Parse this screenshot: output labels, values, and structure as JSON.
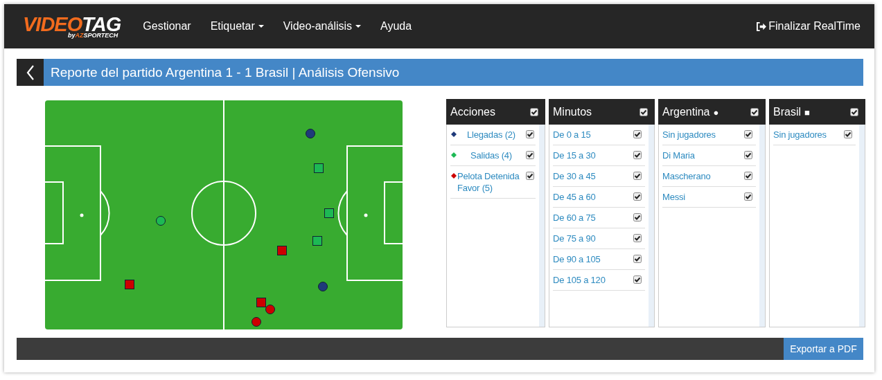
{
  "logo": {
    "main_a": "VIDEO",
    "main_b": "TAG",
    "by": "by",
    "brand_a": "AZ",
    "brand_b": "SPORTECH"
  },
  "nav": [
    {
      "label": "Gestionar",
      "has_dropdown": false
    },
    {
      "label": "Etiquetar",
      "has_dropdown": true
    },
    {
      "label": "Video-análisis",
      "has_dropdown": true
    },
    {
      "label": "Ayuda",
      "has_dropdown": false
    }
  ],
  "exit_button": "Finalizar RealTime",
  "title": "Reporte del partido Argentina 1 - 1 Brasil | Análisis Ofensivo",
  "panels": [
    {
      "title": "Acciones",
      "checked": true,
      "items": [
        {
          "label": "Llegadas (2)",
          "checked": true,
          "color": "#1f3a7a"
        },
        {
          "label": "Salidas (4)",
          "checked": true,
          "color": "#1db954"
        },
        {
          "label": "Pelota Detenida Favor (5)",
          "checked": true,
          "color": "#cc0000"
        }
      ]
    },
    {
      "title": "Minutos",
      "checked": true,
      "items": [
        {
          "label": "De 0 a 15",
          "checked": true
        },
        {
          "label": "De 15 a 30",
          "checked": true
        },
        {
          "label": "De 30 a 45",
          "checked": true
        },
        {
          "label": "De 45 a 60",
          "checked": true
        },
        {
          "label": "De 60 a 75",
          "checked": true
        },
        {
          "label": "De 75 a 90",
          "checked": true
        },
        {
          "label": "De 90 a 105",
          "checked": true
        },
        {
          "label": "De 105 a 120",
          "checked": true
        }
      ]
    },
    {
      "title": "Argentina",
      "symbol": "●",
      "checked": true,
      "items": [
        {
          "label": "Sin jugadores",
          "checked": true
        },
        {
          "label": "Di Maria",
          "checked": true
        },
        {
          "label": "Mascherano",
          "checked": true
        },
        {
          "label": "Messi",
          "checked": true
        }
      ]
    },
    {
      "title": "Brasil",
      "symbol": "■",
      "checked": true,
      "items": [
        {
          "label": "Sin jugadores",
          "checked": true
        }
      ]
    }
  ],
  "export_button": "Exportar a PDF"
}
